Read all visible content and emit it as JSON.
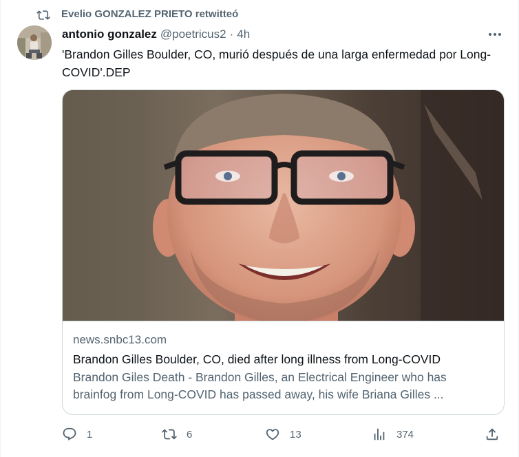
{
  "retweet": {
    "icon": "retweet-icon",
    "text": "Evelio GONZALEZ PRIETO retwitteó"
  },
  "tweet": {
    "author_name": "antonio gonzalez",
    "author_handle": "@poetricus2",
    "separator": "·",
    "time": "4h",
    "text": "'Brandon Gilles Boulder, CO, murió después de una larga enfermedad por Long-COVID'.DEP"
  },
  "card": {
    "domain": "news.snbc13.com",
    "title": "Brandon Gilles Boulder, CO, died after long illness from Long-COVID",
    "description": "Brandon Giles Death - Brandon Gilles, an Electrical Engineer who has brainfog from Long-COVID has passed away, his wife Briana Gilles ..."
  },
  "actions": {
    "replies": "1",
    "retweets": "6",
    "likes": "13",
    "views": "374"
  },
  "colors": {
    "text_primary": "#0f1419",
    "text_secondary": "#536471",
    "border": "#cfd9de"
  }
}
